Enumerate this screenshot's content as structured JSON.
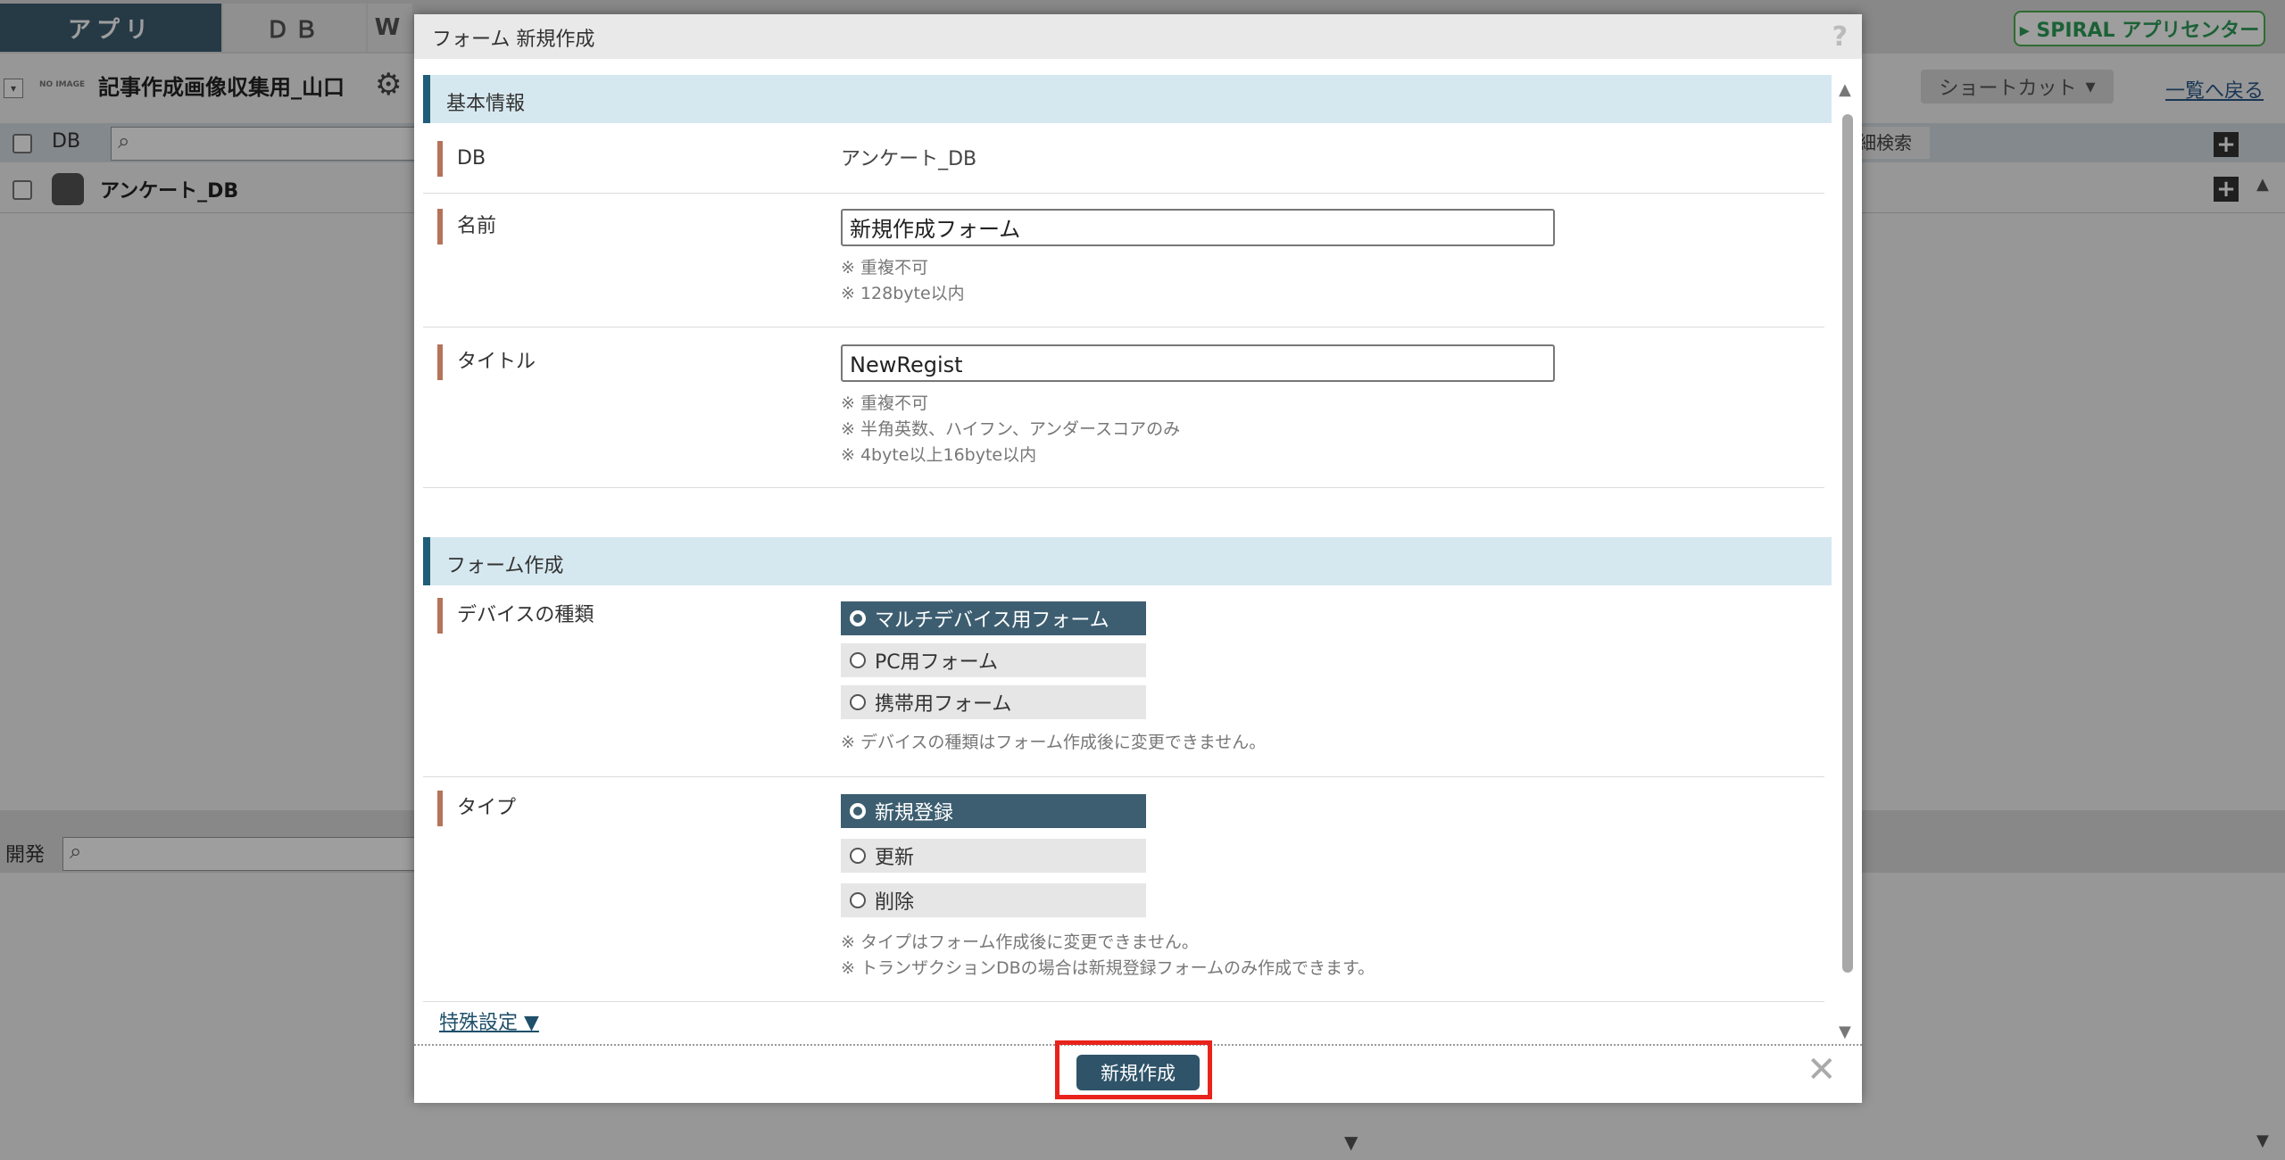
{
  "background": {
    "tabs": [
      {
        "label": "アプリ"
      },
      {
        "label": "ＤＢ"
      },
      {
        "label": "W"
      }
    ],
    "spiral_label": "▸ SPIRAL アプリセンター",
    "app_title": "記事作成画像収集用_山口",
    "noimage": "NO IMAGE",
    "shortcut_label": "ショートカット",
    "back_link": "一覧へ戻る",
    "db_header_label": "DB",
    "detail_search": "細検索",
    "db_row_name": "アンケート_DB",
    "dev_label": "開発"
  },
  "modal": {
    "title": "フォーム 新規作成",
    "help": "?",
    "section_basic": "基本情報",
    "rows": {
      "db_label": "DB",
      "db_value": "アンケート_DB",
      "name_label": "名前",
      "name_value": "新規作成フォーム",
      "name_notes": [
        "※ 重複不可",
        "※ 128byte以内"
      ],
      "title_label": "タイトル",
      "title_value": "NewRegist",
      "title_notes": [
        "※ 重複不可",
        "※ 半角英数、ハイフン、アンダースコアのみ",
        "※ 4byte以上16byte以内"
      ]
    },
    "section_form": "フォーム作成",
    "device": {
      "label": "デバイスの種類",
      "options": [
        "マルチデバイス用フォーム",
        "PC用フォーム",
        "携帯用フォーム"
      ],
      "selected": "マルチデバイス用フォーム",
      "note": "※ デバイスの種類はフォーム作成後に変更できません。"
    },
    "type": {
      "label": "タイプ",
      "options": [
        "新規登録",
        "更新",
        "削除"
      ],
      "selected": "新規登録",
      "notes": [
        "※ タイプはフォーム作成後に変更できません。",
        "※ トランザクションDBの場合は新規登録フォームのみ作成できます。"
      ]
    },
    "special_settings": "特殊設定 ▼",
    "submit": "新規作成",
    "close": "✕"
  },
  "colors": {
    "accent": "#3d5e71",
    "section_bg": "#d6e8ef",
    "highlight": "#e8231c"
  }
}
